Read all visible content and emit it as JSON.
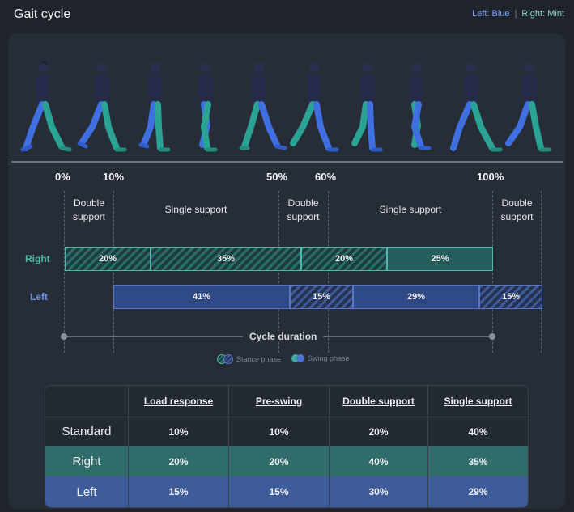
{
  "header": {
    "title": "Gait cycle"
  },
  "legend_top": {
    "left": "Left: Blue",
    "separator": "|",
    "right": "Right: Mint"
  },
  "colors": {
    "mint": "#4fb7a8",
    "blue": "#5877c6",
    "background": "#1f242b",
    "panel": "#272d36"
  },
  "percent_markers": [
    "0%",
    "10%",
    "50%",
    "60%",
    "100%"
  ],
  "phase_labels": {
    "double_support_1": [
      "Double",
      "support"
    ],
    "single_support_1": "Single support",
    "double_support_2": [
      "Double",
      "support"
    ],
    "single_support_2": "Single support",
    "double_support_3": [
      "Double",
      "support"
    ]
  },
  "rows": {
    "right": {
      "label": "Right",
      "segments": [
        "20%",
        "35%",
        "20%",
        "25%"
      ]
    },
    "left": {
      "label": "Left",
      "segments": [
        "41%",
        "15%",
        "29%",
        "15%"
      ]
    }
  },
  "cycle_duration": "Cycle duration",
  "phase_legend": {
    "stance": "Stance phase",
    "swing": "Swing phase"
  },
  "table": {
    "headers": [
      "",
      "Load response",
      "Pre-swing",
      "Double support",
      "Single support"
    ],
    "rows": [
      {
        "label": "Standard",
        "values": [
          "10%",
          "10%",
          "20%",
          "40%"
        ]
      },
      {
        "label": "Right",
        "values": [
          "20%",
          "20%",
          "40%",
          "35%"
        ]
      },
      {
        "label": "Left",
        "values": [
          "15%",
          "15%",
          "30%",
          "29%"
        ]
      }
    ]
  }
}
